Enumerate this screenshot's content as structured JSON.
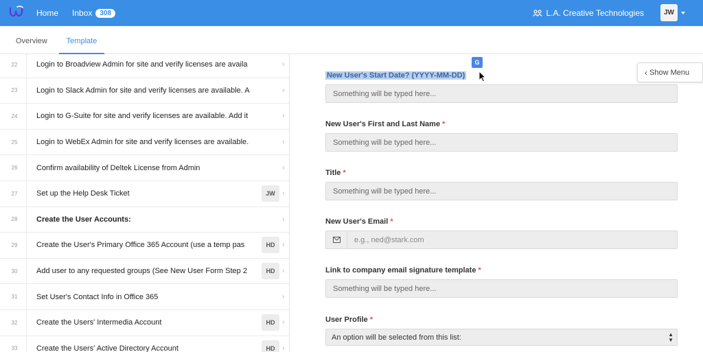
{
  "nav": {
    "home": "Home",
    "inbox": "Inbox",
    "inbox_count": "308",
    "org": "L.A. Creative Technologies",
    "avatar": "JW"
  },
  "tabs": [
    "Overview",
    "Template"
  ],
  "steps": [
    {
      "num": "22",
      "text": "Login to Broadview Admin for site and verify licenses are availa",
      "bold": false,
      "assignee": ""
    },
    {
      "num": "23",
      "text": "Login to Slack Admin for site and verify licenses are available. A",
      "bold": false,
      "assignee": ""
    },
    {
      "num": "24",
      "text": "Login to G-Suite for site and verify licenses are available. Add it",
      "bold": false,
      "assignee": ""
    },
    {
      "num": "25",
      "text": "Login to WebEx Admin for site and verify licenses are available.",
      "bold": false,
      "assignee": ""
    },
    {
      "num": "26",
      "text": "Confirm availability of Deltek License from Admin",
      "bold": false,
      "assignee": ""
    },
    {
      "num": "27",
      "text": "Set up the Help Desk Ticket",
      "bold": false,
      "assignee": "JW"
    },
    {
      "num": "28",
      "text": "Create the User Accounts:",
      "bold": true,
      "assignee": ""
    },
    {
      "num": "29",
      "text": "Create the User's Primary Office 365 Account (use a temp pas",
      "bold": false,
      "assignee": "HD"
    },
    {
      "num": "30",
      "text": "Add user to any requested groups (See New User Form Step 2",
      "bold": false,
      "assignee": "HD"
    },
    {
      "num": "31",
      "text": "Set User's Contact Info in Office 365",
      "bold": false,
      "assignee": ""
    },
    {
      "num": "32",
      "text": "Create the Users' Intermedia Account",
      "bold": false,
      "assignee": "HD"
    },
    {
      "num": "33",
      "text": "Create the Users' Active Directory Account",
      "bold": false,
      "assignee": "HD"
    }
  ],
  "form": {
    "start_date_label": "New User's Start Date? (YYYY-MM-DD)",
    "start_date_placeholder": "Something will be typed here...",
    "name_label": "New User's First and Last Name",
    "name_placeholder": "Something will be typed here...",
    "title_label": "Title",
    "title_placeholder": "Something will be typed here...",
    "email_label": "New User's Email",
    "email_placeholder": "e.g., ned@stark.com",
    "signature_label": "Link to company email signature template",
    "signature_placeholder": "Something will be typed here...",
    "profile_label": "User Profile",
    "profile_placeholder": "An option will be selected from this list:",
    "required_mark": "*"
  },
  "show_menu": "Show Menu",
  "colors": {
    "brand": "#3a8ee6",
    "required": "#d9534f",
    "highlight": "#b9cfea"
  }
}
